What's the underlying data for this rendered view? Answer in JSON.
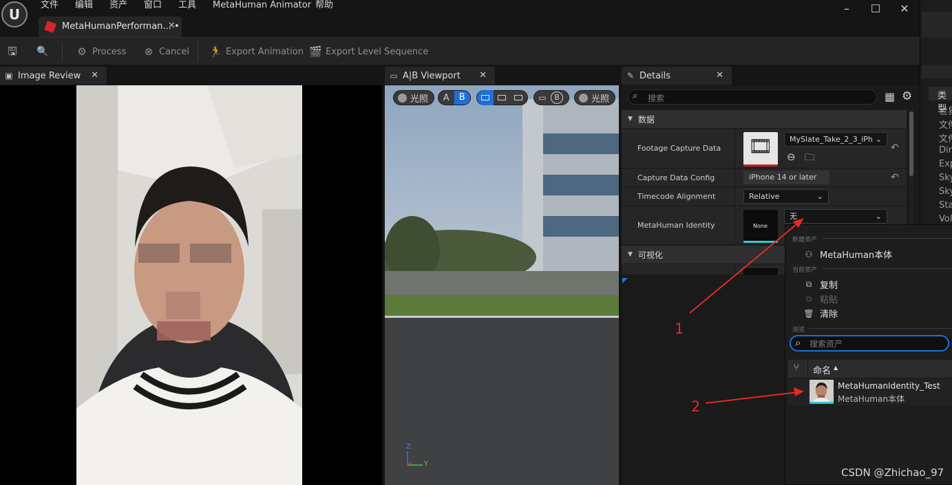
{
  "menu": {
    "file": "文件",
    "edit": "编辑",
    "asset": "资产",
    "window": "窗口",
    "tools": "工具",
    "metahuman_animator": "MetaHuman Animator",
    "help": "帮助"
  },
  "document_tab": {
    "label": "MetaHumanPerforman...",
    "modified_marker": "•"
  },
  "toolbar": {
    "process": "Process",
    "cancel": "Cancel",
    "export_animation": "Export Animation",
    "export_level_sequence": "Export Level Sequence"
  },
  "image_review": {
    "title": "Image Review"
  },
  "viewport": {
    "title": "A|B Viewport",
    "lighting_a": "光照",
    "a": "A",
    "b": "B",
    "b2": "B",
    "lighting_b": "光照",
    "axis_z": "Z",
    "axis_y": "Y"
  },
  "details": {
    "title": "Details",
    "search_placeholder": "搜索",
    "category_data": "数据",
    "category_visual": "可视化",
    "footage_capture_data": {
      "label": "Footage Capture Data",
      "value": "MySlate_Take_2_3_iPh"
    },
    "capture_data_config": {
      "label": "Capture Data Config",
      "value": "iPhone 14 or later"
    },
    "timecode_alignment": {
      "label": "Timecode Alignment",
      "value": "Relative"
    },
    "metahuman_identity": {
      "label": "MetaHuman Identity",
      "thumb_text": "None",
      "value": "无"
    }
  },
  "popup": {
    "section_new": "新建资产",
    "new_metahuman": "MetaHuman本体",
    "section_current": "当前资产",
    "copy": "复制",
    "paste": "粘贴",
    "clear": "清除",
    "section_browse": "浏览",
    "search_placeholder": "搜索资产",
    "column_name": "命名",
    "sort_indicator": "▲",
    "asset": {
      "name": "MetaHumanIdentity_Test",
      "type": "MetaHuman本体"
    }
  },
  "right_strip": {
    "header": "类型",
    "items": [
      "世界",
      "文件",
      "文件",
      "Dire",
      "Exp",
      "Sky",
      "Sky",
      "Sta",
      "Vol"
    ]
  },
  "annotations": {
    "one": "1",
    "two": "2"
  },
  "watermark": "CSDN @Zhichao_97",
  "colors": {
    "accent_blue": "#1f6fd6",
    "annotation_red": "#e22b22",
    "tab_red": "#d2262d"
  }
}
